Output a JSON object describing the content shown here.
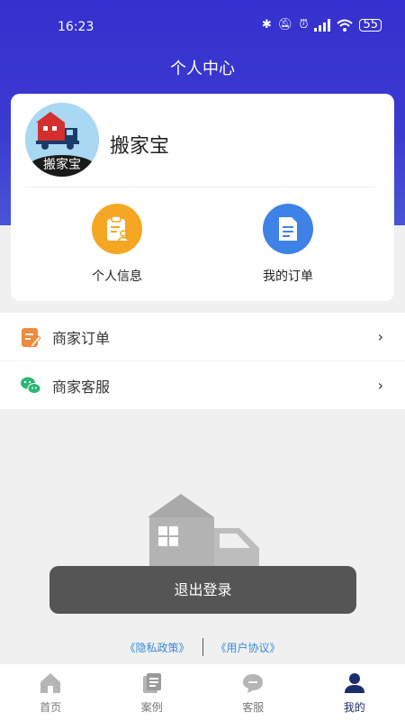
{
  "status_bar": {
    "time": "16:23",
    "battery": "55"
  },
  "header": {
    "title": "个人中心"
  },
  "profile": {
    "username": "搬家宝",
    "avatar_text": "搬家宝",
    "quick_actions": [
      {
        "label": "个人信息",
        "color": "#f5a623"
      },
      {
        "label": "我的订单",
        "color": "#3e82e8"
      }
    ]
  },
  "menu": [
    {
      "label": "商家订单",
      "arrow": "›"
    },
    {
      "label": "商家客服",
      "arrow": "›"
    }
  ],
  "logout_label": "退出登录",
  "links": {
    "privacy": "《隐私政策》",
    "agreement": "《用户协议》"
  },
  "tabs": [
    {
      "label": "首页",
      "icon": "home-icon"
    },
    {
      "label": "案例",
      "icon": "document-icon"
    },
    {
      "label": "客服",
      "icon": "chat-icon"
    },
    {
      "label": "我的",
      "icon": "user-icon",
      "active": true
    }
  ],
  "colors": {
    "header": "#3530cf",
    "accent_tab": "#1c2d6b",
    "link": "#3a8ad8"
  }
}
